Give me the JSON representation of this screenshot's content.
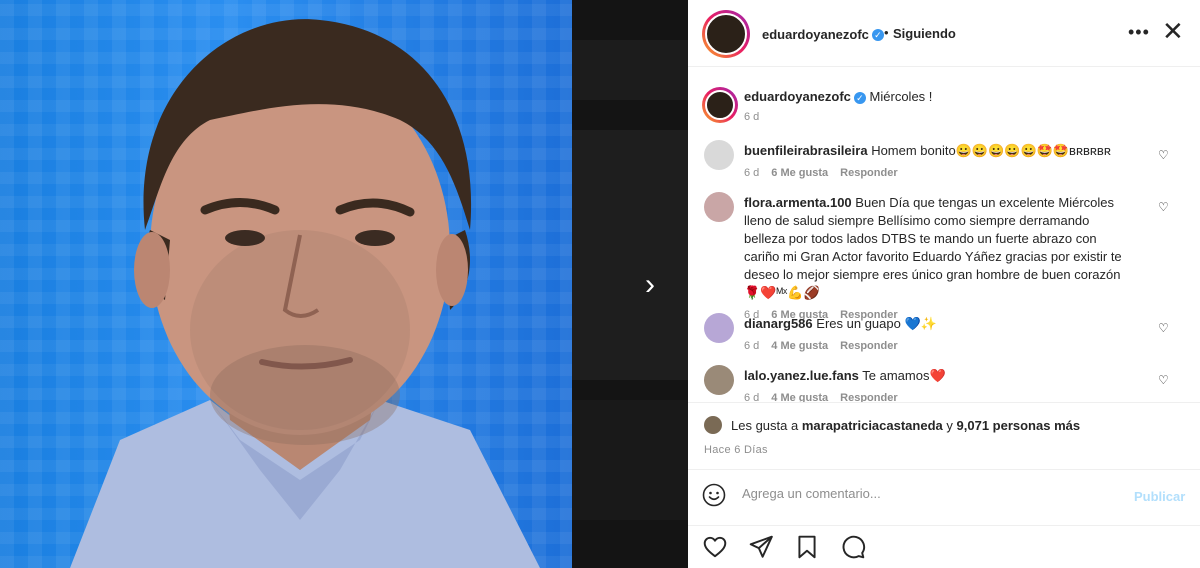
{
  "post": {
    "username": "eduardoyanezofc",
    "verified_icon": "verified-badge-icon",
    "dot": "•",
    "follow_status": "Siguiendo",
    "more_icon": "•••",
    "close_icon": "✕",
    "next_icon": "›"
  },
  "caption": {
    "username": "eduardoyanezofc",
    "text": "Miércoles !",
    "time": "6 d"
  },
  "comments": [
    {
      "username": "buenfileirabrasileira",
      "text": "Homem bonito😀😀😀😀😀🤩🤩ʙʀʙʀʙʀ",
      "time": "6 d",
      "likes": "6 Me gusta",
      "reply": "Responder",
      "avatar_color": "#d9d9d9"
    },
    {
      "username": "flora.armenta.100",
      "text": "Buen Día que tengas un excelente Miércoles lleno de salud siempre Bellísimo como siempre derramando belleza por todos lados DTBS te mando un fuerte abrazo con cariño mi Gran Actor favorito Eduardo Yáñez gracias por existir te deseo lo mejor siempre eres único gran hombre de buen corazón 🌹❤️ᴹˣ💪🏈",
      "time": "6 d",
      "likes": "6 Me gusta",
      "reply": "Responder",
      "avatar_color": "#c9a6a6"
    },
    {
      "username": "dianarg586",
      "text": "Eres un guapo 💙✨",
      "time": "6 d",
      "likes": "4 Me gusta",
      "reply": "Responder",
      "avatar_color": "#b7a7d6"
    },
    {
      "username": "lalo.yanez.lue.fans",
      "text": "Te amamos❤️",
      "time": "6 d",
      "likes": "4 Me gusta",
      "reply": "Responder",
      "avatar_color": "#9a8a78"
    }
  ],
  "likes": {
    "prefix": "Les gusta a",
    "user": "marapatriciacastaneda",
    "joiner": "y",
    "others": "9,071 personas más"
  },
  "posted": "Hace 6 Días",
  "composer": {
    "placeholder": "Agrega un comentario...",
    "publish": "Publicar"
  },
  "colors": {
    "verified": "#3897f0",
    "publish_disabled": "#b2dffc",
    "muted_text": "#8e8e8e",
    "primary_text": "#262626"
  }
}
